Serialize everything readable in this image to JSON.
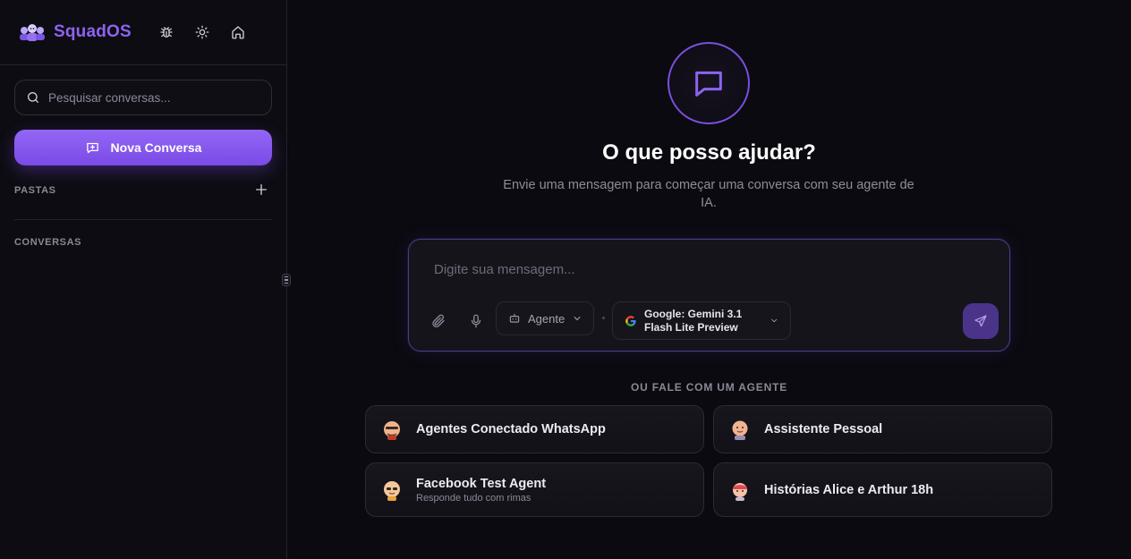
{
  "sidebar": {
    "brand": "SquadOS",
    "icons": [
      "bug-icon",
      "sun-icon",
      "home-icon"
    ],
    "search_placeholder": "Pesquisar conversas...",
    "new_chat_label": "Nova Conversa",
    "folders_label": "PASTAS",
    "conversations_label": "CONVERSAS"
  },
  "hero": {
    "title": "O que posso ajudar?",
    "subtitle": "Envie uma mensagem para começar uma conversa com seu agente de IA."
  },
  "composer": {
    "placeholder": "Digite sua mensagem...",
    "agent_select": "Agente",
    "model_select": "Google: Gemini 3.1 Flash Lite Preview"
  },
  "agents": {
    "section_label": "OU FALE COM UM AGENTE",
    "items": [
      {
        "name": "Agentes Conectado WhatsApp",
        "description": ""
      },
      {
        "name": "Assistente Pessoal",
        "description": ""
      },
      {
        "name": "Facebook Test Agent",
        "description": "Responde tudo com rimas"
      },
      {
        "name": "Histórias Alice e Arthur 18h",
        "description": ""
      }
    ]
  },
  "colors": {
    "accent": "#8d63f0",
    "background": "#0b0a10",
    "sidebar": "#0d0c12"
  }
}
